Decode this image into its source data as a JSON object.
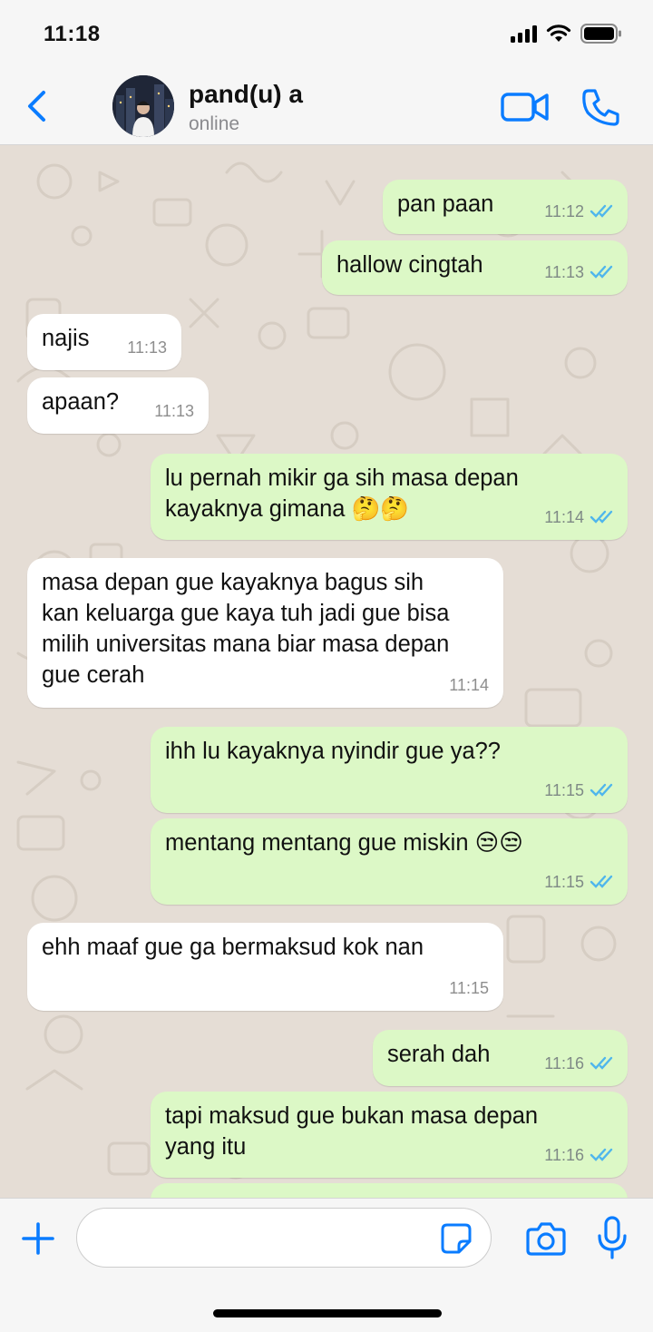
{
  "status_bar": {
    "time": "11:18"
  },
  "header": {
    "contact_name": "pand(u) a",
    "contact_status": "online"
  },
  "colors": {
    "accent": "#0a7cff",
    "outgoing_bubble": "#dcf8c6",
    "incoming_bubble": "#ffffff",
    "read_ticks": "#4fb6ec",
    "chat_wallpaper": "#e5ddd5"
  },
  "messages": [
    {
      "direction": "outgoing",
      "text": "pan paan",
      "time": "11:12",
      "read": true
    },
    {
      "direction": "outgoing",
      "text": "hallow cingtah",
      "time": "11:13",
      "read": true
    },
    {
      "direction": "incoming",
      "text": "najis",
      "time": "11:13"
    },
    {
      "direction": "incoming",
      "text": "apaan?",
      "time": "11:13"
    },
    {
      "direction": "outgoing",
      "text": "lu pernah mikir ga sih masa depan\nkayaknya gimana 🤔🤔",
      "time": "11:14",
      "read": true
    },
    {
      "direction": "incoming",
      "text": "masa depan gue kayaknya bagus sih\nkan keluarga gue kaya tuh jadi gue bisa\nmilih universitas mana biar masa depan\ngue cerah",
      "time": "11:14"
    },
    {
      "direction": "outgoing",
      "text": "ihh lu kayaknya nyindir gue ya??",
      "time": "11:15",
      "read": true
    },
    {
      "direction": "outgoing",
      "text": "mentang mentang gue miskin 😒😒",
      "time": "11:15",
      "read": true
    },
    {
      "direction": "incoming",
      "text": "ehh maaf gue ga bermaksud kok nan",
      "time": "11:15"
    },
    {
      "direction": "outgoing",
      "text": "serah dah",
      "time": "11:16",
      "read": true
    },
    {
      "direction": "outgoing",
      "text": "tapi maksud gue bukan masa depan\nyang itu",
      "time": "11:16",
      "read": true
    }
  ],
  "input": {
    "value": "",
    "placeholder": ""
  },
  "icons": {
    "back": "chevron-left-icon",
    "video": "video-camera-icon",
    "call": "phone-icon",
    "plus": "plus-icon",
    "sticker": "sticker-icon",
    "camera": "camera-icon",
    "mic": "microphone-icon"
  }
}
